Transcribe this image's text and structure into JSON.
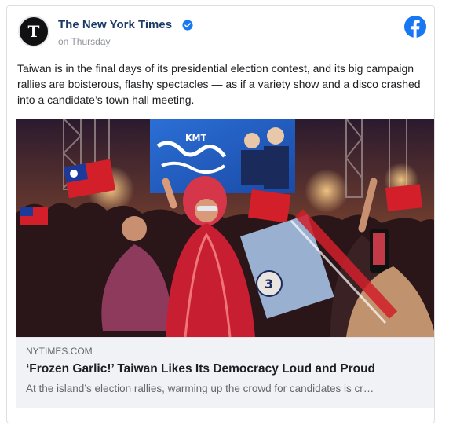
{
  "post": {
    "page_name": "The New York Times",
    "timestamp": "on Thursday",
    "verified_icon": "verified-badge-icon",
    "platform_icon": "facebook-icon",
    "text": "Taiwan is in the final days of its presidential election contest, and its big campaign rallies are boisterous, flashy spectacles — as if a variety show and a disco crashed into a candidate’s town hall meeting."
  },
  "link_preview": {
    "domain": "NYTIMES.COM",
    "headline": "‘Frozen Garlic!’ Taiwan Likes Its Democracy Loud and Proud",
    "description": "At the island’s election rallies, warming up the crowd for candidates is cr…",
    "image": {
      "billboard_text": "KMT",
      "campaign_sign_number": "3"
    }
  },
  "colors": {
    "page_name": "#1c3a66",
    "verified": "#1877f2",
    "facebook_brand": "#1877f2",
    "meta_background": "#f0f2f5"
  }
}
